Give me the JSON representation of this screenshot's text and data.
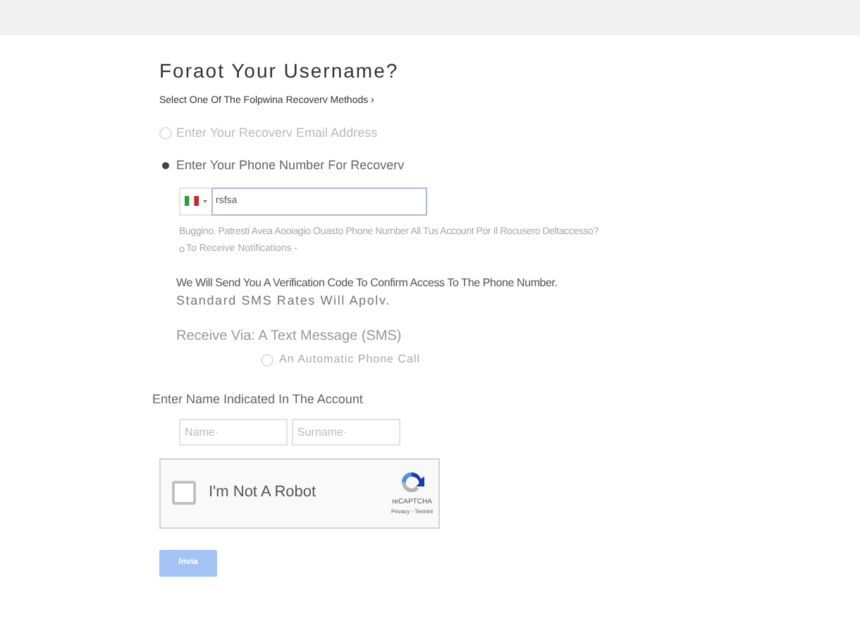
{
  "title": "Foraot Your Username?",
  "instruction": "Select One Of The Folpwina Recoverv Methods ›",
  "methods": [
    {
      "label": "Enter Your Recoverv Email Address",
      "selected": false
    },
    {
      "label": "Enter Your Phone Number For Recoverv",
      "selected": true
    }
  ],
  "phone": {
    "value": "rsfsa"
  },
  "hint": "Buggino. Patresti Avea Aooiagio Ouasto Phone Number All Tus Account Por Il Rocusero Deltaccesso?",
  "notifications": "To Receive Notifications -",
  "verification": "We Will Send You A Verification Code To Confirm Access To The Phone Number.",
  "rates": "Standard SMS Rates Will Apolv.",
  "receive_via": "Receive Via: A Text Message (SMS)",
  "call_option": {
    "label": "An Automatic Phone Call",
    "selected": false
  },
  "name_section": {
    "label": "Enter Name Indicated In The Account",
    "name_placeholder": "Name·",
    "surname_placeholder": "Surname·"
  },
  "captcha": {
    "label": "I'm Not A Robot",
    "checked": false,
    "brand": "reCAPTCHA",
    "links": "Privacy - Termini"
  },
  "submit": "Invia"
}
